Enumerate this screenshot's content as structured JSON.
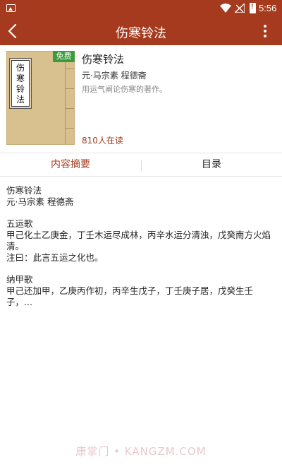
{
  "status_bar": {
    "time": "5:56",
    "icons": [
      "image-notification-icon",
      "wifi-icon",
      "no-signal-icon",
      "battery-alert-icon"
    ]
  },
  "app_bar": {
    "title": "伤寒铃法",
    "back_icon": "chevron-left-icon",
    "more_icon": "more-vertical-icon"
  },
  "book": {
    "cover_label": "伤寒铃法",
    "free_badge": "免费",
    "name": "伤寒铃法",
    "author": "元·马宗素 程德斋",
    "description": "用运气阐论伤寒的著作。",
    "readers": "810人在读"
  },
  "tabs": [
    {
      "label": "内容摘要",
      "active": true
    },
    {
      "label": "目录",
      "active": false
    }
  ],
  "content": {
    "line1": "伤寒铃法",
    "line2": "元·马宗素  程德斋",
    "line3": "五运歌",
    "line4": "甲己化土乙庚金，丁壬木运尽成林，丙辛水运分清浊，戊癸南方火焰清。",
    "line5": "注曰：此言五运之化也。",
    "line6": "纳甲歌",
    "line7": "甲己还加甲，乙庚丙作初，丙辛生戊子，丁壬庚子居，戊癸生壬子，..."
  },
  "watermark": "康掌门 • KANGZM.COM",
  "colors": {
    "primary": "#a53a1e",
    "free_badge": "#3a9d3a",
    "cover": "#d9c08f"
  }
}
